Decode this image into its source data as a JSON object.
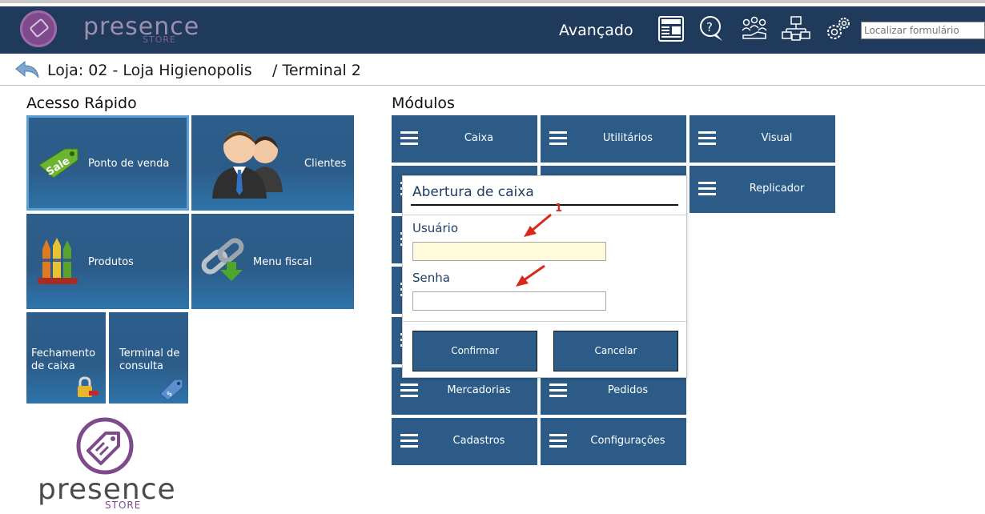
{
  "header": {
    "brand": "presence",
    "brand_sub": "STORE",
    "advanced_label": "Avançado",
    "icons": [
      "news-icon",
      "help-icon",
      "users-icon",
      "network-icon",
      "settings-icon"
    ],
    "search_placeholder": "Localizar formulário"
  },
  "breadcrumb": {
    "store": "Loja: 02 - Loja Higienopolis",
    "terminal": "/ Terminal 2"
  },
  "quick_access": {
    "title": "Acesso Rápido",
    "tiles": [
      {
        "label": "Ponto de venda",
        "icon": "sale-tag-icon",
        "badge": "Sale"
      },
      {
        "label": "Clientes",
        "icon": "clients-icon"
      },
      {
        "label": "Produtos",
        "icon": "crayons-icon"
      },
      {
        "label": "Menu fiscal",
        "icon": "chain-link-icon"
      },
      {
        "label": "Fechamento de caixa",
        "icon": "lock-icon"
      },
      {
        "label": "Terminal de consulta",
        "icon": "price-tag-icon"
      }
    ]
  },
  "modules": {
    "title": "Módulos",
    "items": [
      "Caixa",
      "Utilitários",
      "Visual",
      "Replicador",
      "Mercadorias",
      "Pedidos",
      "Cadastros",
      "Configurações"
    ]
  },
  "modal": {
    "title": "Abertura de caixa",
    "user_label": "Usuário",
    "user_value": "",
    "password_label": "Senha",
    "password_value": "",
    "confirm_label": "Confirmar",
    "cancel_label": "Cancelar",
    "step_marker": "1"
  },
  "footer_logo": {
    "brand": "presence",
    "brand_sub": "STORE"
  },
  "colors": {
    "header_bg": "#1f3a5a",
    "tile_bg": "#2b5b86",
    "brand_purple": "#7e4a8c",
    "annotation_red": "#d8271c"
  }
}
